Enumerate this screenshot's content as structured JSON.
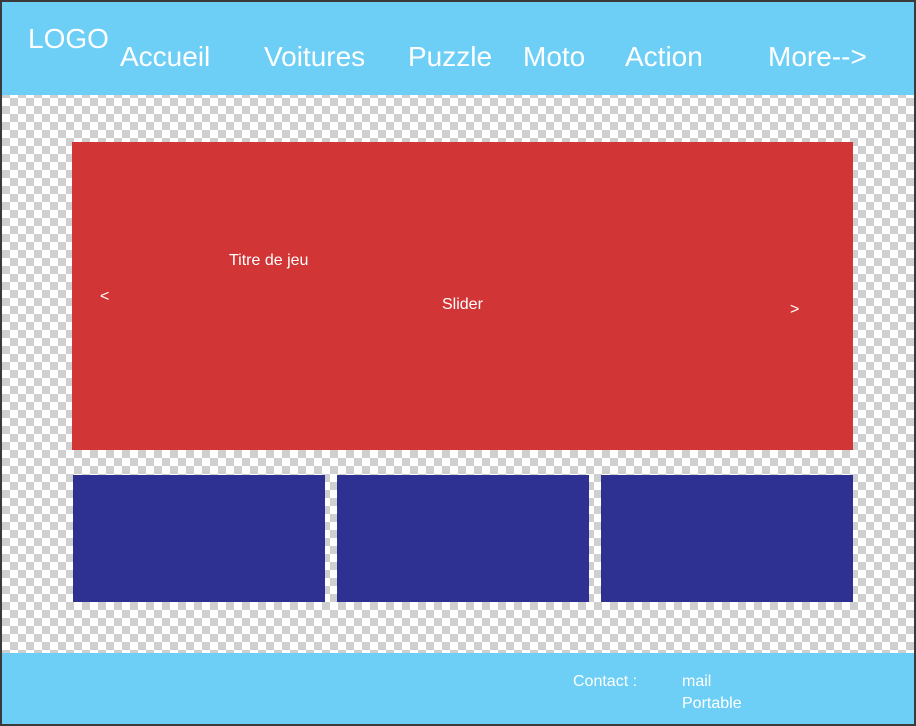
{
  "header": {
    "logo": "LOGO",
    "nav": [
      {
        "label": "Accueil"
      },
      {
        "label": "Voitures"
      },
      {
        "label": "Puzzle"
      },
      {
        "label": "Moto"
      },
      {
        "label": "Action"
      },
      {
        "label": "More-->"
      }
    ]
  },
  "slider": {
    "game_title": "Titre de jeu",
    "label": "Slider",
    "prev": "<",
    "next": ">"
  },
  "footer": {
    "contact_label": "Contact :",
    "mail": "mail",
    "phone": "Portable"
  },
  "colors": {
    "header_footer": "#6dcff6",
    "slider": "#d13535",
    "cards": "#2e3192"
  }
}
